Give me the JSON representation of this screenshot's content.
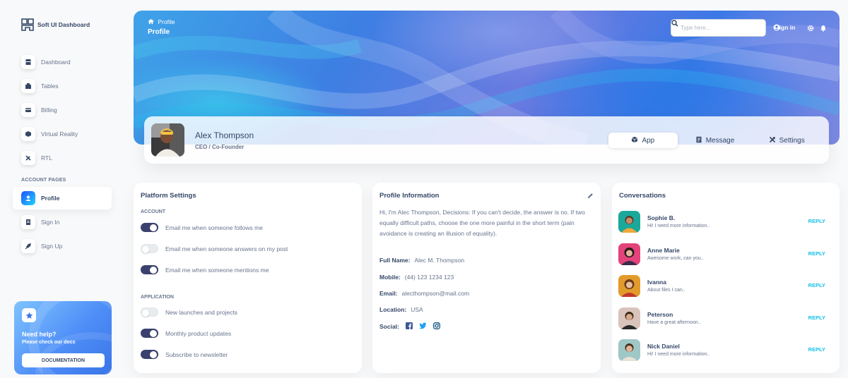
{
  "brand": {
    "name": "Soft UI Dashboard",
    "logo_icon": "building-logo-icon"
  },
  "sidebar": {
    "items": [
      {
        "label": "Dashboard",
        "icon": "shop-icon"
      },
      {
        "label": "Tables",
        "icon": "office-icon"
      },
      {
        "label": "Billing",
        "icon": "credit-card-icon"
      },
      {
        "label": "Virtual Reality",
        "icon": "box-3d-icon"
      },
      {
        "label": "RTL",
        "icon": "settings-tools-icon"
      }
    ],
    "section_title": "ACCOUNT PAGES",
    "account_items": [
      {
        "label": "Profile",
        "icon": "customer-support-icon",
        "active": true
      },
      {
        "label": "Sign In",
        "icon": "document-icon"
      },
      {
        "label": "Sign Up",
        "icon": "spaceship-icon"
      }
    ],
    "help": {
      "title": "Need help?",
      "subtitle": "Please check our docs",
      "button": "DOCUMENTATION",
      "icon": "star-icon"
    }
  },
  "navbar": {
    "breadcrumb_home_icon": "home-icon",
    "breadcrumb_separator": "/",
    "breadcrumb_current": "Profile",
    "page_title": "Profile",
    "search_placeholder": "Type here...",
    "sign_in": "Sign in"
  },
  "profile": {
    "name": "Alex Thompson",
    "role": "CEO / Co-Founder",
    "tabs": [
      {
        "label": "App",
        "icon": "cube-icon",
        "active": true
      },
      {
        "label": "Message",
        "icon": "document-icon"
      },
      {
        "label": "Settings",
        "icon": "tools-icon"
      }
    ]
  },
  "platform_settings": {
    "title": "Platform Settings",
    "account_heading": "ACCOUNT",
    "account_toggles": [
      {
        "label": "Email me when someone follows me",
        "on": true
      },
      {
        "label": "Email me when someone answers on my post",
        "on": false
      },
      {
        "label": "Email me when someone mentions me",
        "on": true
      }
    ],
    "application_heading": "APPLICATION",
    "application_toggles": [
      {
        "label": "New launches and projects",
        "on": false
      },
      {
        "label": "Monthly product updates",
        "on": true
      },
      {
        "label": "Subscribe to newsletter",
        "on": true
      }
    ]
  },
  "profile_info": {
    "title": "Profile Information",
    "description": "Hi, I'm Alec Thompson, Decisions: If you can't decide, the answer is no. If two equally difficult paths, choose the one more painful in the short term (pain avoidance is creating an illusion of equality).",
    "full_name_label": "Full Name:",
    "full_name": "Alec M. Thompson",
    "mobile_label": "Mobile:",
    "mobile": "(44) 123 1234 123",
    "email_label": "Email:",
    "email": "alecthompson@mail.com",
    "location_label": "Location:",
    "location": "USA",
    "social_label": "Social:",
    "social_icons": [
      "facebook-icon",
      "twitter-icon",
      "instagram-icon"
    ]
  },
  "conversations": {
    "title": "Conversations",
    "reply_label": "REPLY",
    "items": [
      {
        "name": "Sophie B.",
        "message": "Hi! I need more information..",
        "color": "#1aa89a"
      },
      {
        "name": "Anne Marie",
        "message": "Awesome work, can you..",
        "color": "#e3427a"
      },
      {
        "name": "Ivanna",
        "message": "About files I can..",
        "color": "#e29b2b"
      },
      {
        "name": "Peterson",
        "message": "Have a great afternoon..",
        "color": "#c98a7c"
      },
      {
        "name": "Nick Daniel",
        "message": "Hi! I need more information..",
        "color": "#6fa6a8"
      }
    ]
  }
}
